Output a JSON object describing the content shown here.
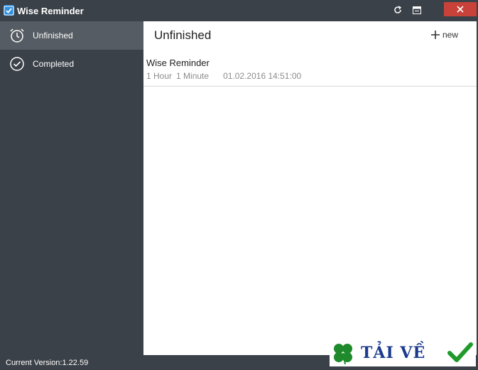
{
  "window": {
    "title": "Wise Reminder",
    "icons": {
      "app": "calendar-check-icon",
      "refresh": "refresh-icon",
      "settings": "window-menu-icon",
      "close": "close-icon"
    }
  },
  "sidebar": {
    "items": [
      {
        "label": "Unfinished",
        "icon": "alarm-clock-icon",
        "active": true
      },
      {
        "label": "Completed",
        "icon": "check-circle-icon",
        "active": false
      }
    ]
  },
  "main": {
    "title": "Unfinished",
    "new_label": "new",
    "reminders": [
      {
        "title": "Wise Reminder",
        "hours": "1 Hour",
        "minutes": "1 Minute",
        "datetime": "01.02.2016 14:51:00"
      }
    ]
  },
  "footer": {
    "version": "Current Version:1.22.59"
  },
  "watermark": {
    "text": "TẢI VỀ"
  },
  "colors": {
    "sidebar_bg": "#3b4148",
    "active_item": "#565c63",
    "close_red": "#c9423a",
    "content_bg": "#ffffff"
  }
}
